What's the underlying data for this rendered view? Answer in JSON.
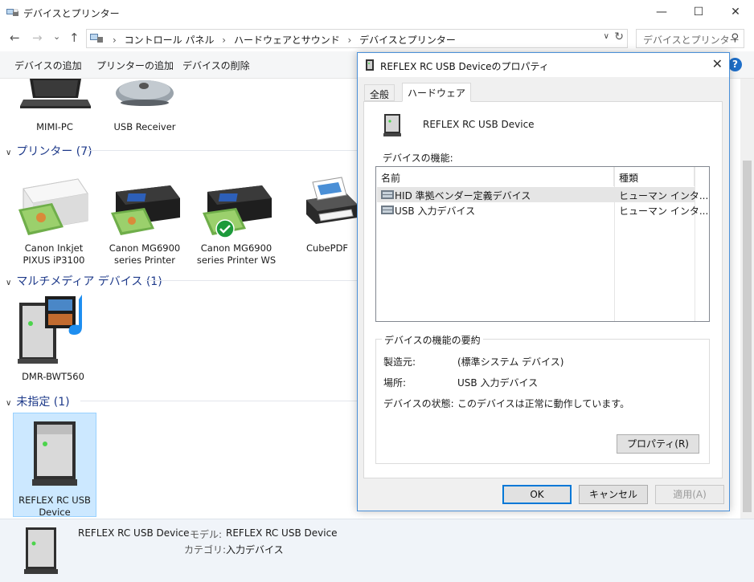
{
  "window": {
    "title": "デバイスとプリンター",
    "minimize": "—",
    "maximize": "☐",
    "close": "✕"
  },
  "nav": {
    "back": "←",
    "forward": "→",
    "history": "⌄",
    "up": "↑",
    "breadcrumbs": [
      "コントロール パネル",
      "ハードウェアとサウンド",
      "デバイスとプリンター"
    ],
    "search_placeholder": "デバイスとプリンター"
  },
  "commands": {
    "add_device": "デバイスの追加",
    "add_printer": "プリンターの追加",
    "remove_device": "デバイスの削除"
  },
  "top_devices": [
    {
      "label": "MIMI-PC"
    },
    {
      "label": "USB Receiver"
    }
  ],
  "groups": {
    "printers": "プリンター (7)",
    "multimedia": "マルチメディア デバイス (1)",
    "unspecified": "未指定 (1)"
  },
  "printers": [
    {
      "label": "Canon Inkjet PIXUS iP3100"
    },
    {
      "label": "Canon MG6900 series Printer"
    },
    {
      "label": "Canon MG6900 series Printer WS"
    },
    {
      "label": "CubePDF"
    }
  ],
  "multimedia": [
    {
      "label": "DMR-BWT560"
    }
  ],
  "unspecified": [
    {
      "label": "REFLEX RC USB Device"
    }
  ],
  "status": {
    "name": "REFLEX RC USB Device",
    "model_label": "モデル:",
    "model_value": "REFLEX RC USB Device",
    "category_label": "カテゴリ:",
    "category_value": "入力デバイス"
  },
  "dialog": {
    "title": "REFLEX RC USB Deviceのプロパティ",
    "close": "✕",
    "tabs": [
      "全般",
      "ハードウェア"
    ],
    "active_tab": 1,
    "device_name": "REFLEX RC USB Device",
    "functions_label": "デバイスの機能:",
    "columns": [
      "名前",
      "種類"
    ],
    "rows": [
      {
        "name": "HID 準拠ベンダー定義デバイス",
        "type": "ヒューマン インタ..."
      },
      {
        "name": "USB 入力デバイス",
        "type": "ヒューマン インタ..."
      }
    ],
    "summary_title": "デバイスの機能の要約",
    "summary": [
      {
        "key": "製造元:",
        "value": "(標準システム デバイス)"
      },
      {
        "key": "場所:",
        "value": "USB 入力デバイス"
      },
      {
        "key": "デバイスの状態:",
        "value": "このデバイスは正常に動作しています。"
      }
    ],
    "properties_button": "プロパティ(R)",
    "ok": "OK",
    "cancel": "キャンセル",
    "apply": "適用(A)"
  }
}
